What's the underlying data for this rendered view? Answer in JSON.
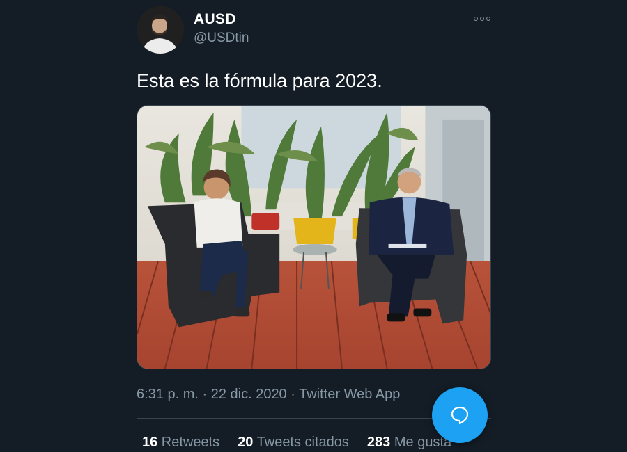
{
  "tweet": {
    "author": {
      "display_name": "AUSD",
      "handle": "@USDtin",
      "avatar_icon": "user-avatar"
    },
    "more_icon": "more-options-icon",
    "text": "Esta es la fórmula para 2023.",
    "media_icon": "photo",
    "timestamp": "6:31 p. m. · 22 dic. 2020 · ",
    "source": "Twitter Web App",
    "stats": {
      "retweets_count": "16",
      "retweets_label": " Retweets",
      "quotes_count": "20",
      "quotes_label": " Tweets citados",
      "likes_count": "283",
      "likes_label": " Me gusta"
    }
  },
  "fab": {
    "icon": "compose-reply-icon"
  },
  "colors": {
    "background": "#141d26",
    "text_primary": "#ffffff",
    "text_secondary": "#8899a6",
    "accent": "#1da1f2",
    "divider": "#38444d"
  }
}
